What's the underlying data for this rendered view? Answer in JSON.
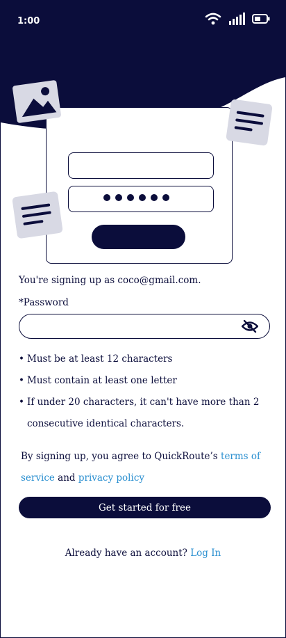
{
  "status_bar": {
    "time": "1:00"
  },
  "signup": {
    "email_notice": "You're signing up as coco@gmail.com.",
    "password_label": "*Password",
    "password_value": "",
    "rules": [
      "Must be at least 12 characters",
      "Must contain at least one letter",
      "If under 20 characters, it can't have more than 2 consecutive identical characters."
    ],
    "agreement_prefix": "By signing up, you agree to QuickRoute’s ",
    "terms_link": "terms of service",
    "agreement_join": " and ",
    "privacy_link": "privacy policy",
    "submit_label": "Get started for free",
    "login_prompt": "Already have an account?",
    "login_link": "Log In"
  },
  "colors": {
    "navy": "#0b0d3b",
    "link": "#2a8fd0",
    "card_gray": "#d8d9e4"
  }
}
